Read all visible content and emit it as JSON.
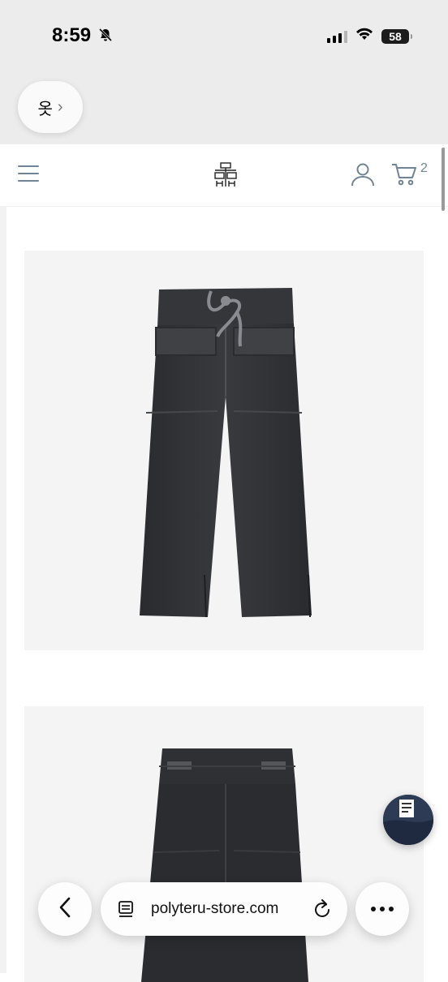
{
  "status_bar": {
    "time": "8:59",
    "battery": "58"
  },
  "translate_button": {
    "label": "옷",
    "chevron": "›"
  },
  "header": {
    "cart_count": "2"
  },
  "browser": {
    "url": "polyteru-store.com"
  },
  "icons": [
    "bell-slash-icon",
    "signal-icon",
    "wifi-icon",
    "battery-icon",
    "menu-icon",
    "logo",
    "account-icon",
    "cart-icon",
    "back-icon",
    "tabs-icon",
    "reload-icon",
    "more-icon"
  ],
  "colors": {
    "header_icon": "#6f8494",
    "product_bg": "#f4f4f4",
    "pants": "#2f3034"
  }
}
